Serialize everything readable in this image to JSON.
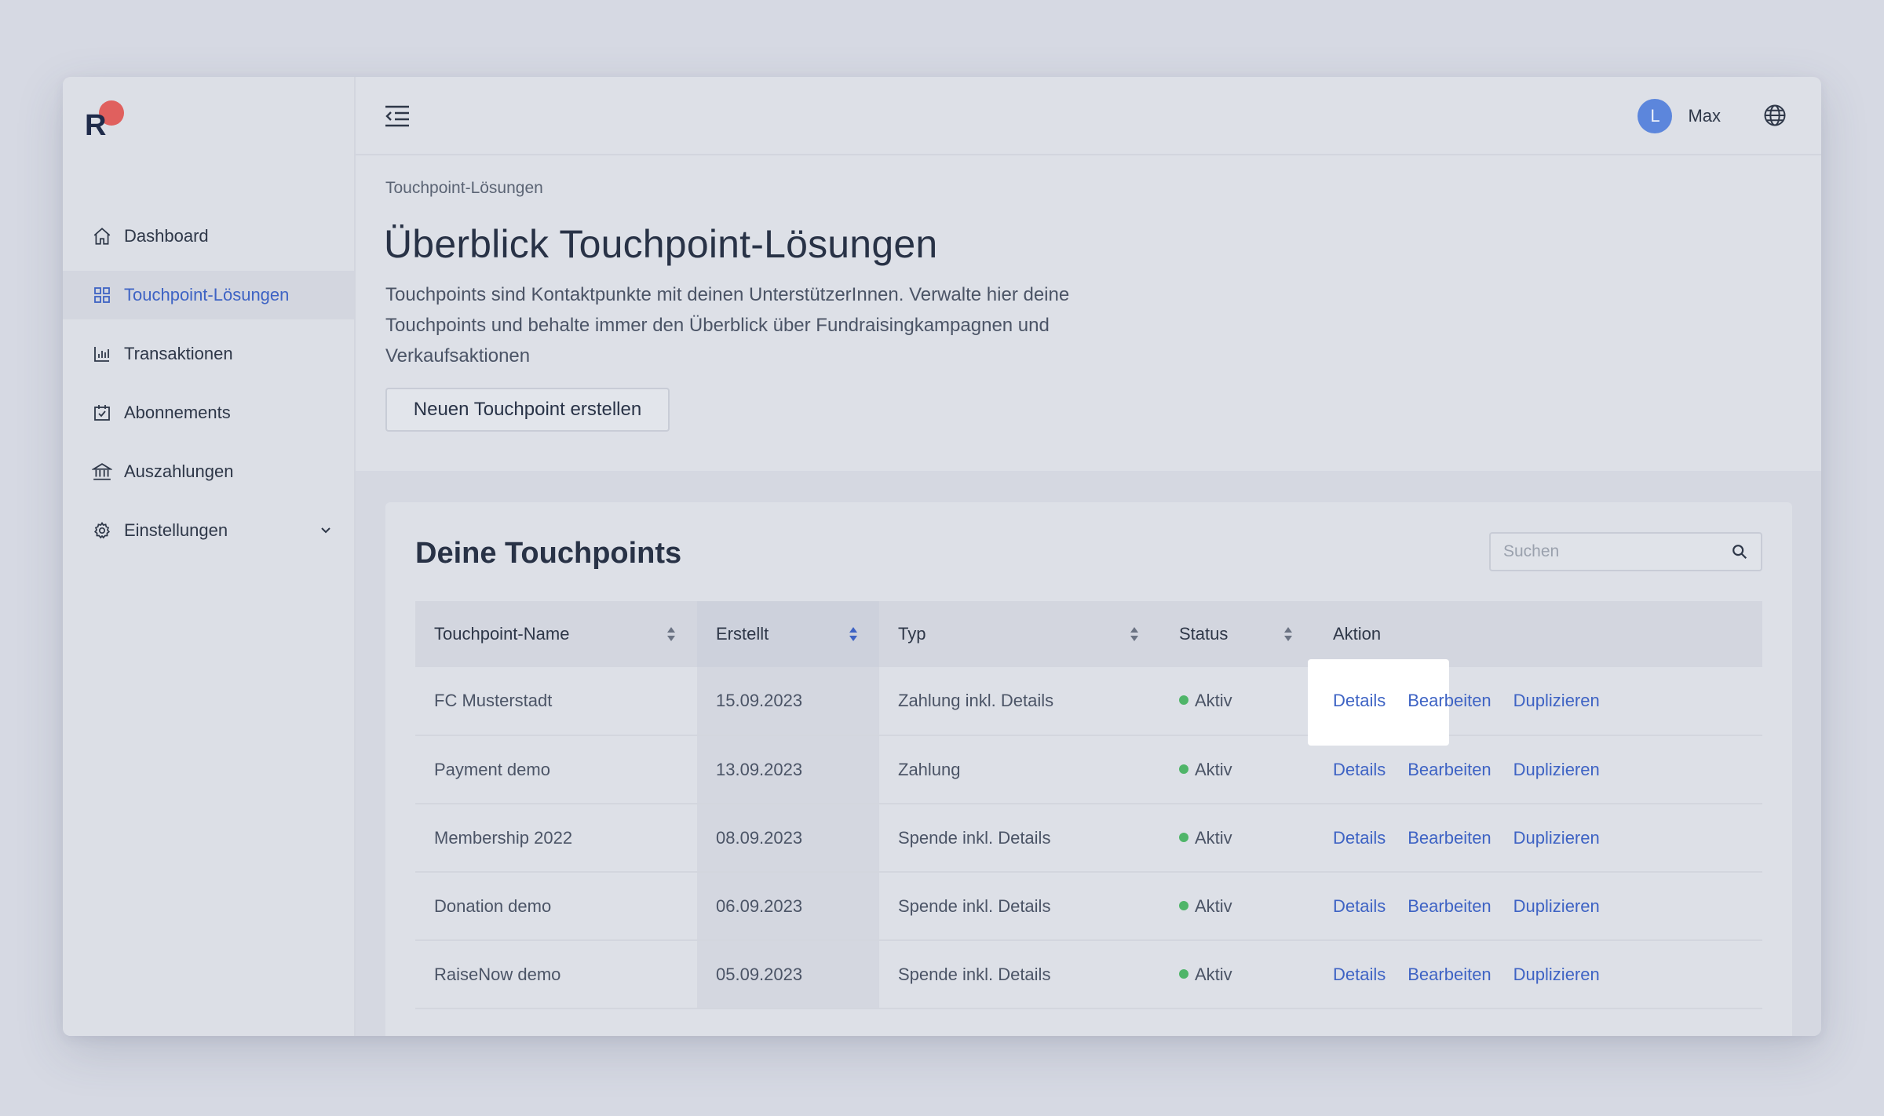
{
  "sidebar": {
    "logo_text": "R",
    "items": [
      {
        "label": "Dashboard",
        "icon": "home-icon"
      },
      {
        "label": "Touchpoint-Lösungen",
        "icon": "grid-icon",
        "active": true
      },
      {
        "label": "Transaktionen",
        "icon": "bar-chart-icon"
      },
      {
        "label": "Abonnements",
        "icon": "calendar-check-icon"
      },
      {
        "label": "Auszahlungen",
        "icon": "bank-icon"
      },
      {
        "label": "Einstellungen",
        "icon": "gear-icon",
        "expandable": true
      }
    ]
  },
  "header": {
    "avatar_initial": "L",
    "username": "Max"
  },
  "main": {
    "breadcrumb": "Touchpoint-Lösungen",
    "title": "Überblick Touchpoint-Lösungen",
    "description": "Touchpoints sind Kontaktpunkte mit deinen UnterstützerInnen. Verwalte hier deine Touchpoints und behalte immer den Überblick über Fundraisingkampagnen und Verkaufsaktionen",
    "create_button": "Neuen Touchpoint erstellen"
  },
  "card": {
    "title": "Deine Touchpoints",
    "search_placeholder": "Suchen",
    "columns": [
      "Touchpoint-Name",
      "Erstellt",
      "Typ",
      "Status",
      "Aktion"
    ],
    "rows": [
      {
        "name": "FC Musterstadt",
        "created": "15.09.2023",
        "type": "Zahlung inkl. Details",
        "status": "Aktiv"
      },
      {
        "name": "Payment demo",
        "created": "13.09.2023",
        "type": "Zahlung",
        "status": "Aktiv"
      },
      {
        "name": "Membership 2022",
        "created": "08.09.2023",
        "type": "Spende inkl. Details",
        "status": "Aktiv"
      },
      {
        "name": "Donation demo",
        "created": "06.09.2023",
        "type": "Spende inkl. Details",
        "status": "Aktiv"
      },
      {
        "name": "RaiseNow demo",
        "created": "05.09.2023",
        "type": "Spende inkl. Details",
        "status": "Aktiv"
      }
    ],
    "actions": {
      "details": "Details",
      "edit": "Bearbeiten",
      "duplicate": "Duplizieren"
    }
  },
  "colors": {
    "accent": "#3e63c4",
    "status_active": "#4fb569",
    "logo_red": "#e0524f",
    "logo_dark": "#1f2b4a",
    "avatar": "#5c86dc"
  }
}
